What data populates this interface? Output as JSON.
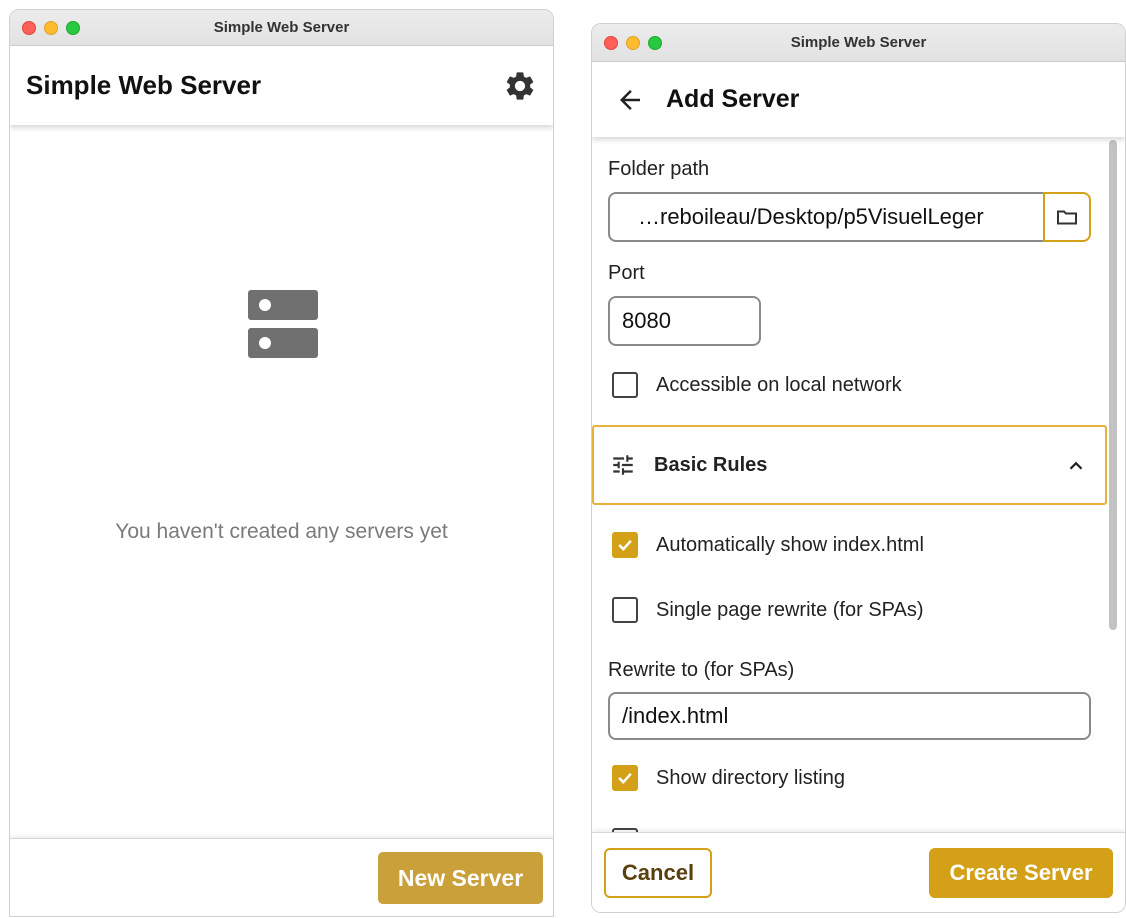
{
  "left_window": {
    "window_title": "Simple Web Server",
    "app_title": "Simple Web Server",
    "settings_icon": "gear-icon",
    "empty_icon": "server-icon",
    "empty_message": "You haven't created any servers yet",
    "new_server_label": "New Server"
  },
  "right_window": {
    "window_title": "Simple Web Server",
    "back_icon": "arrow-left-icon",
    "page_title": "Add Server",
    "folder_label": "Folder path",
    "folder_value": "…reboileau/Desktop/p5VisuelLeger",
    "folder_icon": "folder-icon",
    "port_label": "Port",
    "port_value": "8080",
    "local_network_label": "Accessible on local network",
    "local_network_checked": false,
    "section": {
      "icon": "tune-icon",
      "title": "Basic Rules",
      "expanded": true,
      "toggle_icon": "chevron-up-icon"
    },
    "rules": [
      {
        "label": "Automatically show index.html",
        "checked": true
      },
      {
        "label": "Single page rewrite (for SPAs)",
        "checked": false
      }
    ],
    "rewrite_label": "Rewrite to (for SPAs)",
    "rewrite_value": "/index.html",
    "directory_listing_label": "Show directory listing",
    "directory_listing_checked": true,
    "cancel_label": "Cancel",
    "create_label": "Create Server"
  },
  "colors": {
    "accent": "#d4a017",
    "new_server_button": "#c9a03a",
    "muted_text": "#7a7a7a"
  }
}
